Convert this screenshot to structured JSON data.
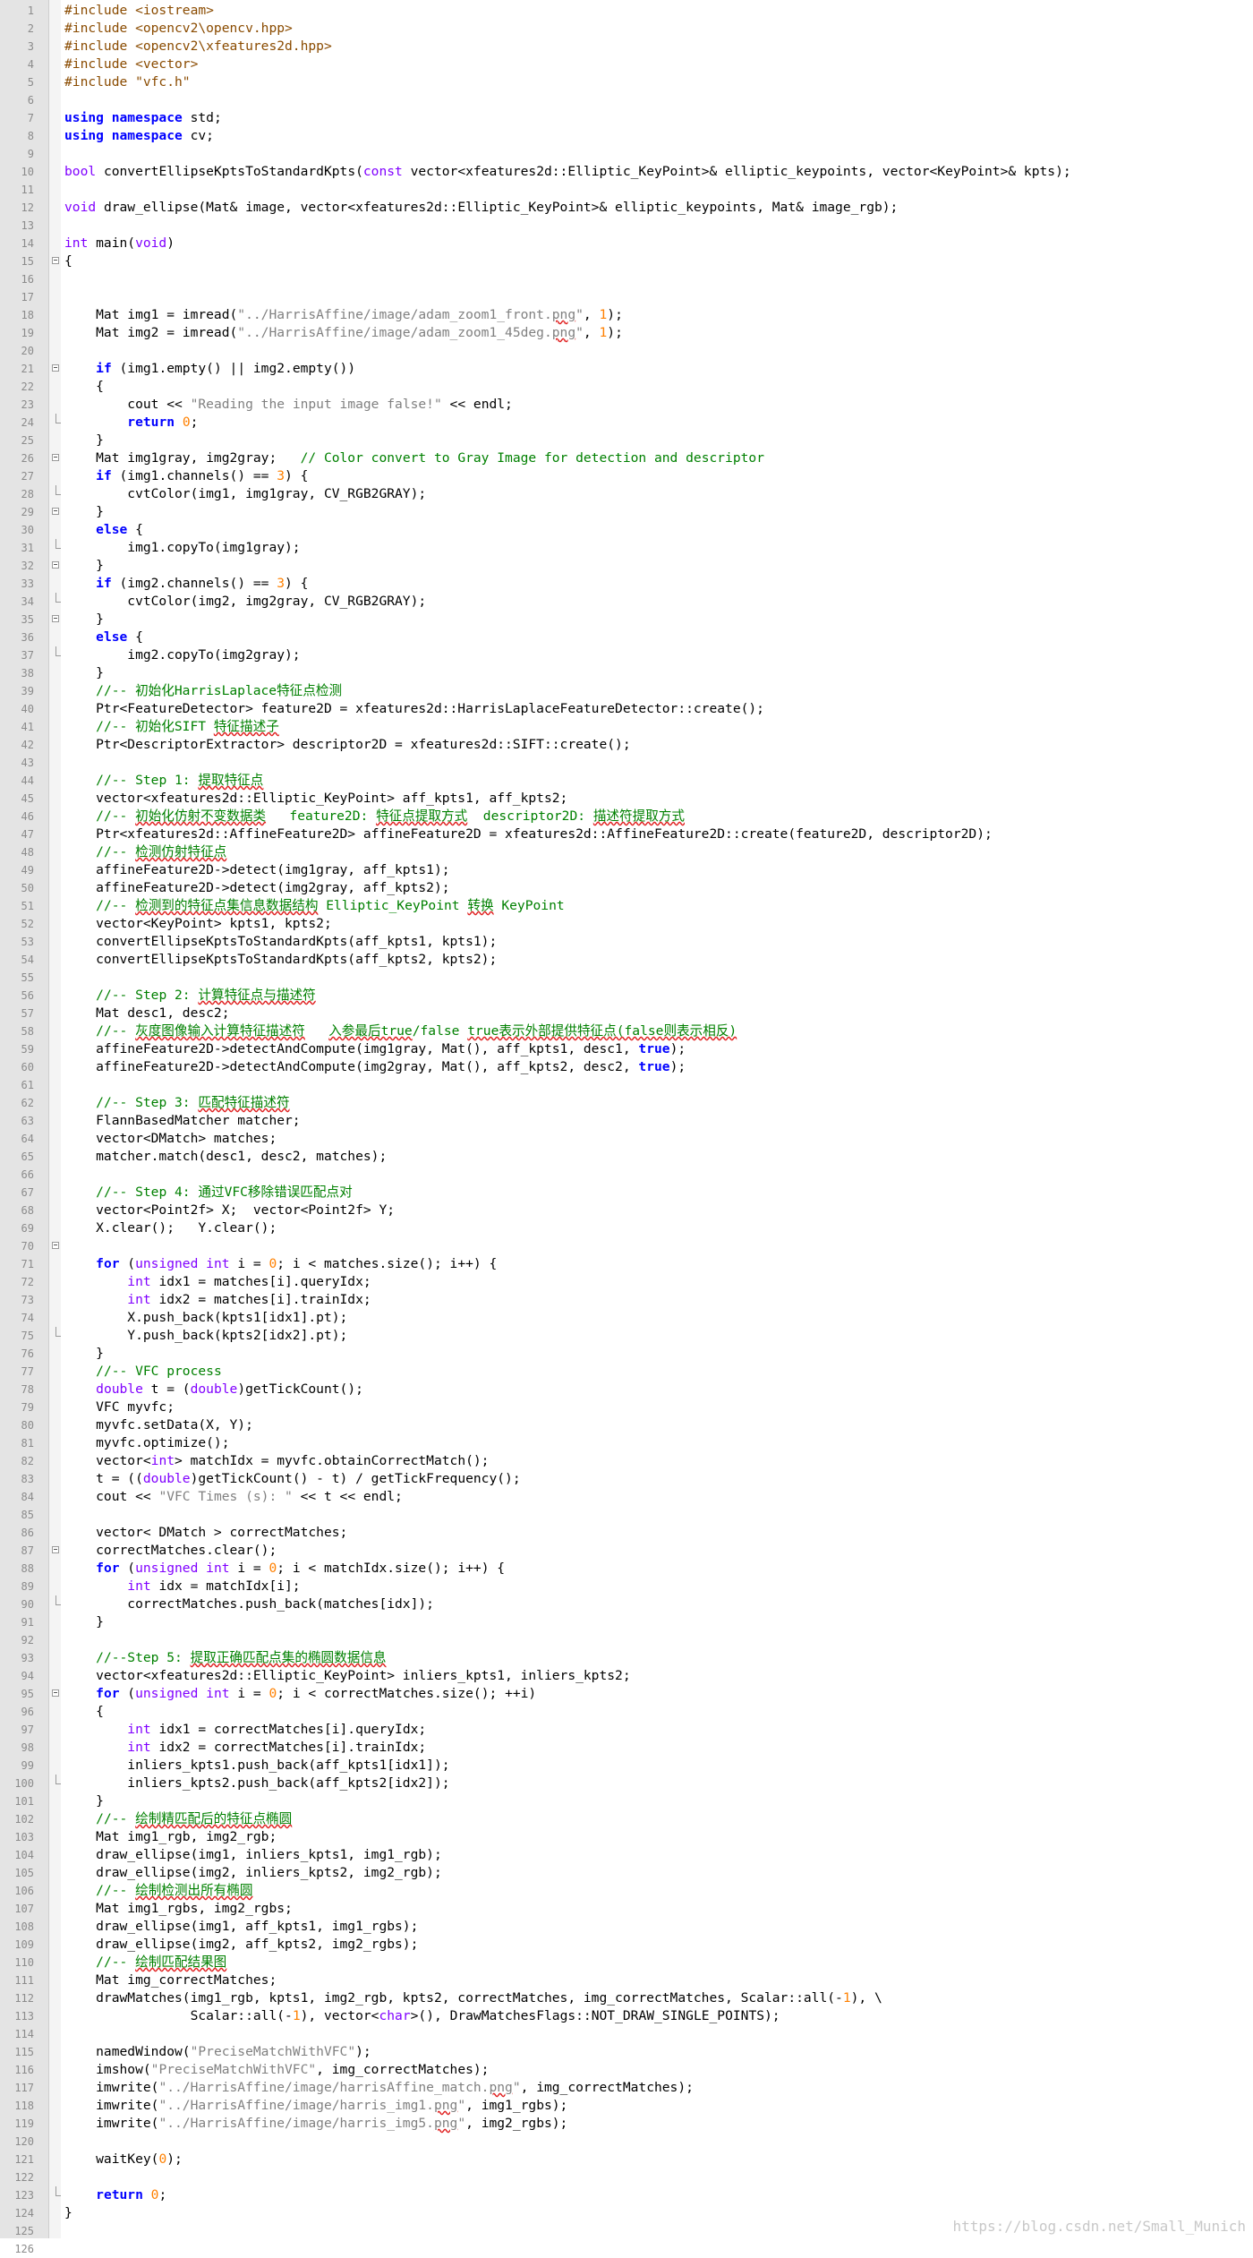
{
  "watermark": "https://blog.csdn.net/Small_Munich",
  "lines": [
    [
      [
        "pp",
        "#include <iostream>"
      ]
    ],
    [
      [
        "pp",
        "#include <opencv2\\opencv.hpp>"
      ]
    ],
    [
      [
        "pp",
        "#include <opencv2\\xfeatures2d.hpp>"
      ]
    ],
    [
      [
        "pp",
        "#include <vector>"
      ]
    ],
    [
      [
        "pp",
        "#include \"vfc.h\""
      ]
    ],
    [],
    [
      [
        "kw",
        "using namespace"
      ],
      [
        "tx",
        " std;"
      ]
    ],
    [
      [
        "kw",
        "using namespace"
      ],
      [
        "tx",
        " cv;"
      ]
    ],
    [],
    [
      [
        "kwn",
        "bool"
      ],
      [
        "tx",
        " convertEllipseKptsToStandardKpts("
      ],
      [
        "kwn",
        "const"
      ],
      [
        "tx",
        " vector<xfeatures2d::Elliptic_KeyPoint>& elliptic_keypoints, vector<KeyPoint>& kpts);"
      ]
    ],
    [],
    [
      [
        "kwn",
        "void"
      ],
      [
        "tx",
        " draw_ellipse(Mat& image, vector<xfeatures2d::Elliptic_KeyPoint>& elliptic_keypoints, Mat& image_rgb);"
      ]
    ],
    [],
    [
      [
        "kwn",
        "int"
      ],
      [
        "tx",
        " main("
      ],
      [
        "kwn",
        "void"
      ],
      [
        "tx",
        ")"
      ]
    ],
    [
      [
        "tx",
        "{"
      ]
    ],
    [],
    [],
    [
      [
        "tx",
        "    Mat img1 = imread("
      ],
      [
        "str",
        "\"../HarrisAffine/image/adam_zoom1_front."
      ],
      [
        "stru",
        "png"
      ],
      [
        "str",
        "\""
      ],
      [
        "tx",
        ", "
      ],
      [
        "num",
        "1"
      ],
      [
        "tx",
        ");"
      ]
    ],
    [
      [
        "tx",
        "    Mat img2 = imread("
      ],
      [
        "str",
        "\"../HarrisAffine/image/adam_zoom1_45deg."
      ],
      [
        "stru",
        "png"
      ],
      [
        "str",
        "\""
      ],
      [
        "tx",
        ", "
      ],
      [
        "num",
        "1"
      ],
      [
        "tx",
        ");"
      ]
    ],
    [],
    [
      [
        "tx",
        "    "
      ],
      [
        "kw",
        "if"
      ],
      [
        "tx",
        " (img1.empty() || img2.empty())"
      ]
    ],
    [
      [
        "tx",
        "    {"
      ]
    ],
    [
      [
        "tx",
        "        cout << "
      ],
      [
        "str",
        "\"Reading the input image false!\""
      ],
      [
        "tx",
        " << endl;"
      ]
    ],
    [
      [
        "tx",
        "        "
      ],
      [
        "kw",
        "return"
      ],
      [
        "tx",
        " "
      ],
      [
        "num",
        "0"
      ],
      [
        "tx",
        ";"
      ]
    ],
    [
      [
        "tx",
        "    }"
      ]
    ],
    [
      [
        "tx",
        "    Mat img1gray, img2gray;   "
      ],
      [
        "cm",
        "// Color convert to Gray Image for detection and descriptor"
      ]
    ],
    [
      [
        "tx",
        "    "
      ],
      [
        "kw",
        "if"
      ],
      [
        "tx",
        " (img1.channels() == "
      ],
      [
        "num",
        "3"
      ],
      [
        "tx",
        ") {"
      ]
    ],
    [
      [
        "tx",
        "        cvtColor(img1, img1gray, CV_RGB2GRAY);"
      ]
    ],
    [
      [
        "tx",
        "    }"
      ]
    ],
    [
      [
        "tx",
        "    "
      ],
      [
        "kw",
        "else"
      ],
      [
        "tx",
        " {"
      ]
    ],
    [
      [
        "tx",
        "        img1.copyTo(img1gray);"
      ]
    ],
    [
      [
        "tx",
        "    }"
      ]
    ],
    [
      [
        "tx",
        "    "
      ],
      [
        "kw",
        "if"
      ],
      [
        "tx",
        " (img2.channels() == "
      ],
      [
        "num",
        "3"
      ],
      [
        "tx",
        ") {"
      ]
    ],
    [
      [
        "tx",
        "        cvtColor(img2, img2gray, CV_RGB2GRAY);"
      ]
    ],
    [
      [
        "tx",
        "    }"
      ]
    ],
    [
      [
        "tx",
        "    "
      ],
      [
        "kw",
        "else"
      ],
      [
        "tx",
        " {"
      ]
    ],
    [
      [
        "tx",
        "        img2.copyTo(img2gray);"
      ]
    ],
    [
      [
        "tx",
        "    }"
      ]
    ],
    [
      [
        "tx",
        "    "
      ],
      [
        "cm",
        "//-- 初始化HarrisLaplace特征点检测"
      ]
    ],
    [
      [
        "tx",
        "    Ptr<FeatureDetector> feature2D = xfeatures2d::HarrisLaplaceFeatureDetector::create();"
      ]
    ],
    [
      [
        "tx",
        "    "
      ],
      [
        "cm",
        "//-- 初始化SIFT "
      ],
      [
        "cmu",
        "特征描述子"
      ]
    ],
    [
      [
        "tx",
        "    Ptr<DescriptorExtractor> descriptor2D = xfeatures2d::SIFT::create();"
      ]
    ],
    [],
    [
      [
        "tx",
        "    "
      ],
      [
        "cm",
        "//-- Step 1: "
      ],
      [
        "cmu",
        "提取特征点"
      ]
    ],
    [
      [
        "tx",
        "    vector<xfeatures2d::Elliptic_KeyPoint> aff_kpts1, aff_kpts2;"
      ]
    ],
    [
      [
        "tx",
        "    "
      ],
      [
        "cm",
        "//-- "
      ],
      [
        "cmu",
        "初始化仿射不变数据类"
      ],
      [
        "cm",
        "   feature2D: "
      ],
      [
        "cmu",
        "特征点提取方式"
      ],
      [
        "cm",
        "  descriptor2D: "
      ],
      [
        "cmu",
        "描述符提取方式"
      ]
    ],
    [
      [
        "tx",
        "    Ptr<xfeatures2d::AffineFeature2D> affineFeature2D = xfeatures2d::AffineFeature2D::create(feature2D, descriptor2D);"
      ]
    ],
    [
      [
        "tx",
        "    "
      ],
      [
        "cm",
        "//-- "
      ],
      [
        "cmu",
        "检测仿射特征点"
      ]
    ],
    [
      [
        "tx",
        "    affineFeature2D->detect(img1gray, aff_kpts1);"
      ]
    ],
    [
      [
        "tx",
        "    affineFeature2D->detect(img2gray, aff_kpts2);"
      ]
    ],
    [
      [
        "tx",
        "    "
      ],
      [
        "cm",
        "//-- "
      ],
      [
        "cmu",
        "检测到的特征点集信息数据结构"
      ],
      [
        "cm",
        " Elliptic_KeyPoint "
      ],
      [
        "cmu",
        "转换"
      ],
      [
        "cm",
        " KeyPoint"
      ]
    ],
    [
      [
        "tx",
        "    vector<KeyPoint> kpts1, kpts2;"
      ]
    ],
    [
      [
        "tx",
        "    convertEllipseKptsToStandardKpts(aff_kpts1, kpts1);"
      ]
    ],
    [
      [
        "tx",
        "    convertEllipseKptsToStandardKpts(aff_kpts2, kpts2);"
      ]
    ],
    [],
    [
      [
        "tx",
        "    "
      ],
      [
        "cm",
        "//-- Step 2: "
      ],
      [
        "cmu",
        "计算特征点与描述符"
      ]
    ],
    [
      [
        "tx",
        "    Mat desc1, desc2;"
      ]
    ],
    [
      [
        "tx",
        "    "
      ],
      [
        "cm",
        "//-- "
      ],
      [
        "cmu",
        "灰度图像输入计算特征描述符"
      ],
      [
        "cm",
        "   "
      ],
      [
        "cmu",
        "入参最后true"
      ],
      [
        "cm",
        "/false "
      ],
      [
        "cmu",
        "true表示外部提供特征点(false则表示相反)"
      ]
    ],
    [
      [
        "tx",
        "    affineFeature2D->detectAndCompute(img1gray, Mat(), aff_kpts1, desc1, "
      ],
      [
        "kw",
        "true"
      ],
      [
        "tx",
        ");"
      ]
    ],
    [
      [
        "tx",
        "    affineFeature2D->detectAndCompute(img2gray, Mat(), aff_kpts2, desc2, "
      ],
      [
        "kw",
        "true"
      ],
      [
        "tx",
        ");"
      ]
    ],
    [],
    [
      [
        "tx",
        "    "
      ],
      [
        "cm",
        "//-- Step 3: "
      ],
      [
        "cmu",
        "匹配特征描述符"
      ]
    ],
    [
      [
        "tx",
        "    FlannBasedMatcher matcher;"
      ]
    ],
    [
      [
        "tx",
        "    vector<DMatch> matches;"
      ]
    ],
    [
      [
        "tx",
        "    matcher.match(desc1, desc2, matches);"
      ]
    ],
    [],
    [
      [
        "tx",
        "    "
      ],
      [
        "cm",
        "//-- Step 4: 通过VFC移除错误匹配点对"
      ]
    ],
    [
      [
        "tx",
        "    vector<Point2f> X;  vector<Point2f> Y;"
      ]
    ],
    [
      [
        "tx",
        "    X.clear();   Y.clear();"
      ]
    ],
    [],
    [
      [
        "tx",
        "    "
      ],
      [
        "kw",
        "for"
      ],
      [
        "tx",
        " ("
      ],
      [
        "kwn",
        "unsigned int"
      ],
      [
        "tx",
        " i = "
      ],
      [
        "num",
        "0"
      ],
      [
        "tx",
        "; i < matches.size(); i++) {"
      ]
    ],
    [
      [
        "tx",
        "        "
      ],
      [
        "kwn",
        "int"
      ],
      [
        "tx",
        " idx1 = matches[i].queryIdx;"
      ]
    ],
    [
      [
        "tx",
        "        "
      ],
      [
        "kwn",
        "int"
      ],
      [
        "tx",
        " idx2 = matches[i].trainIdx;"
      ]
    ],
    [
      [
        "tx",
        "        X.push_back(kpts1[idx1].pt);"
      ]
    ],
    [
      [
        "tx",
        "        Y.push_back(kpts2[idx2].pt);"
      ]
    ],
    [
      [
        "tx",
        "    }"
      ]
    ],
    [
      [
        "tx",
        "    "
      ],
      [
        "cm",
        "//-- VFC process"
      ]
    ],
    [
      [
        "tx",
        "    "
      ],
      [
        "kwn",
        "double"
      ],
      [
        "tx",
        " t = ("
      ],
      [
        "kwn",
        "double"
      ],
      [
        "tx",
        ")getTickCount();"
      ]
    ],
    [
      [
        "tx",
        "    VFC myvfc;"
      ]
    ],
    [
      [
        "tx",
        "    myvfc.setData(X, Y);"
      ]
    ],
    [
      [
        "tx",
        "    myvfc.optimize();"
      ]
    ],
    [
      [
        "tx",
        "    vector<"
      ],
      [
        "kwn",
        "int"
      ],
      [
        "tx",
        "> matchIdx = myvfc.obtainCorrectMatch();"
      ]
    ],
    [
      [
        "tx",
        "    t = (("
      ],
      [
        "kwn",
        "double"
      ],
      [
        "tx",
        ")getTickCount() - t) / getTickFrequency();"
      ]
    ],
    [
      [
        "tx",
        "    cout << "
      ],
      [
        "str",
        "\"VFC Times (s): \""
      ],
      [
        "tx",
        " << t << endl;"
      ]
    ],
    [],
    [
      [
        "tx",
        "    vector< DMatch > correctMatches;"
      ]
    ],
    [
      [
        "tx",
        "    correctMatches.clear();"
      ]
    ],
    [
      [
        "tx",
        "    "
      ],
      [
        "kw",
        "for"
      ],
      [
        "tx",
        " ("
      ],
      [
        "kwn",
        "unsigned int"
      ],
      [
        "tx",
        " i = "
      ],
      [
        "num",
        "0"
      ],
      [
        "tx",
        "; i < matchIdx.size(); i++) {"
      ]
    ],
    [
      [
        "tx",
        "        "
      ],
      [
        "kwn",
        "int"
      ],
      [
        "tx",
        " idx = matchIdx[i];"
      ]
    ],
    [
      [
        "tx",
        "        correctMatches.push_back(matches[idx]);"
      ]
    ],
    [
      [
        "tx",
        "    }"
      ]
    ],
    [],
    [
      [
        "tx",
        "    "
      ],
      [
        "cm",
        "//--Step 5: "
      ],
      [
        "cmu",
        "提取正确匹配点集的椭圆数据信息"
      ]
    ],
    [
      [
        "tx",
        "    vector<xfeatures2d::Elliptic_KeyPoint> inliers_kpts1, inliers_kpts2;"
      ]
    ],
    [
      [
        "tx",
        "    "
      ],
      [
        "kw",
        "for"
      ],
      [
        "tx",
        " ("
      ],
      [
        "kwn",
        "unsigned int"
      ],
      [
        "tx",
        " i = "
      ],
      [
        "num",
        "0"
      ],
      [
        "tx",
        "; i < correctMatches.size(); ++i)"
      ]
    ],
    [
      [
        "tx",
        "    {"
      ]
    ],
    [
      [
        "tx",
        "        "
      ],
      [
        "kwn",
        "int"
      ],
      [
        "tx",
        " idx1 = correctMatches[i].queryIdx;"
      ]
    ],
    [
      [
        "tx",
        "        "
      ],
      [
        "kwn",
        "int"
      ],
      [
        "tx",
        " idx2 = correctMatches[i].trainIdx;"
      ]
    ],
    [
      [
        "tx",
        "        inliers_kpts1.push_back(aff_kpts1[idx1]);"
      ]
    ],
    [
      [
        "tx",
        "        inliers_kpts2.push_back(aff_kpts2[idx2]);"
      ]
    ],
    [
      [
        "tx",
        "    }"
      ]
    ],
    [
      [
        "tx",
        "    "
      ],
      [
        "cm",
        "//-- "
      ],
      [
        "cmu",
        "绘制精匹配后的特征点椭圆"
      ]
    ],
    [
      [
        "tx",
        "    Mat img1_rgb, img2_rgb;"
      ]
    ],
    [
      [
        "tx",
        "    draw_ellipse(img1, inliers_kpts1, img1_rgb);"
      ]
    ],
    [
      [
        "tx",
        "    draw_ellipse(img2, inliers_kpts2, img2_rgb);"
      ]
    ],
    [
      [
        "tx",
        "    "
      ],
      [
        "cm",
        "//-- "
      ],
      [
        "cmu",
        "绘制检测出所有椭圆"
      ]
    ],
    [
      [
        "tx",
        "    Mat img1_rgbs, img2_rgbs;"
      ]
    ],
    [
      [
        "tx",
        "    draw_ellipse(img1, aff_kpts1, img1_rgbs);"
      ]
    ],
    [
      [
        "tx",
        "    draw_ellipse(img2, aff_kpts2, img2_rgbs);"
      ]
    ],
    [
      [
        "tx",
        "    "
      ],
      [
        "cm",
        "//-- "
      ],
      [
        "cmu",
        "绘制匹配结果图"
      ]
    ],
    [
      [
        "tx",
        "    Mat img_correctMatches;"
      ]
    ],
    [
      [
        "tx",
        "    drawMatches(img1_rgb, kpts1, img2_rgb, kpts2, correctMatches, img_correctMatches, Scalar::all(-"
      ],
      [
        "num",
        "1"
      ],
      [
        "tx",
        "), \\"
      ]
    ],
    [
      [
        "tx",
        "                Scalar::all(-"
      ],
      [
        "num",
        "1"
      ],
      [
        "tx",
        "), vector<"
      ],
      [
        "kwn",
        "char"
      ],
      [
        "tx",
        ">(), DrawMatchesFlags::NOT_DRAW_SINGLE_POINTS);"
      ]
    ],
    [],
    [
      [
        "tx",
        "    namedWindow("
      ],
      [
        "str",
        "\"PreciseMatchWithVFC\""
      ],
      [
        "tx",
        ");"
      ]
    ],
    [
      [
        "tx",
        "    imshow("
      ],
      [
        "str",
        "\"PreciseMatchWithVFC\""
      ],
      [
        "tx",
        ", img_correctMatches);"
      ]
    ],
    [
      [
        "tx",
        "    imwrite("
      ],
      [
        "str",
        "\"../HarrisAffine/image/harrisAffine_match."
      ],
      [
        "stru",
        "png"
      ],
      [
        "str",
        "\""
      ],
      [
        "tx",
        ", img_correctMatches);"
      ]
    ],
    [
      [
        "tx",
        "    imwrite("
      ],
      [
        "str",
        "\"../HarrisAffine/image/harris_img1."
      ],
      [
        "stru",
        "png"
      ],
      [
        "str",
        "\""
      ],
      [
        "tx",
        ", img1_rgbs);"
      ]
    ],
    [
      [
        "tx",
        "    imwrite("
      ],
      [
        "str",
        "\"../HarrisAffine/image/harris_img5."
      ],
      [
        "stru",
        "png"
      ],
      [
        "str",
        "\""
      ],
      [
        "tx",
        ", img2_rgbs);"
      ]
    ],
    [],
    [
      [
        "tx",
        "    waitKey("
      ],
      [
        "num",
        "0"
      ],
      [
        "tx",
        ");"
      ]
    ],
    [],
    [
      [
        "tx",
        "    "
      ],
      [
        "kw",
        "return"
      ],
      [
        "tx",
        " "
      ],
      [
        "num",
        "0"
      ],
      [
        "tx",
        ";"
      ]
    ],
    [
      [
        "tx",
        "}"
      ]
    ],
    [],
    []
  ],
  "fold_open_lines": [
    15,
    21,
    26,
    29,
    32,
    35,
    70,
    87,
    95
  ],
  "fold_end_lines": [
    24,
    28,
    31,
    34,
    37,
    75,
    90,
    100,
    123
  ]
}
